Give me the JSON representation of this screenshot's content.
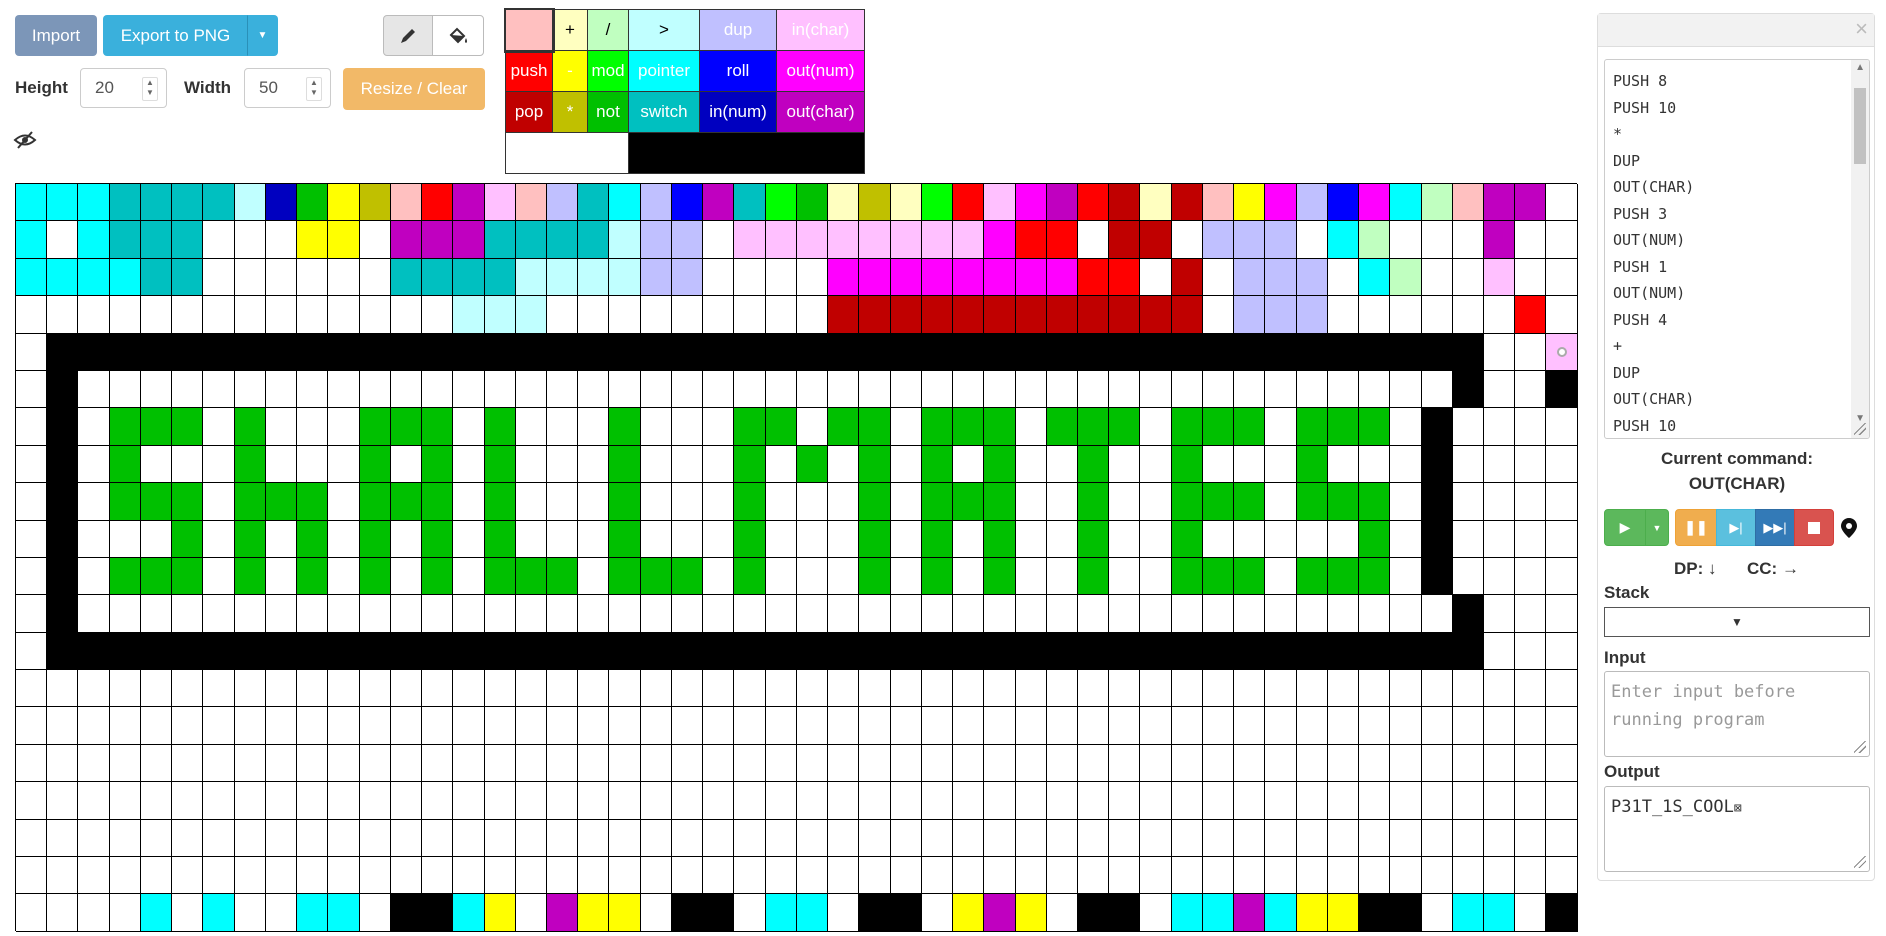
{
  "toolbar": {
    "import_label": "Import",
    "export_label": "Export to PNG",
    "height_label": "Height",
    "height_value": "20",
    "width_label": "Width",
    "width_value": "50",
    "resize_label": "Resize / Clear",
    "icons": {
      "pencil": "pencil-icon",
      "fill": "paint-bucket-icon",
      "eye": "eye-slash-icon"
    }
  },
  "palette": {
    "rows": [
      [
        {
          "label": "",
          "bg": "#ffc0c0",
          "fg": "#000",
          "selected": true
        },
        {
          "label": "+",
          "bg": "#ffffc0",
          "fg": "#000"
        },
        {
          "label": "/",
          "bg": "#c0ffc0",
          "fg": "#000"
        },
        {
          "label": ">",
          "bg": "#c0ffff",
          "fg": "#000"
        },
        {
          "label": "dup",
          "bg": "#c0c0ff",
          "fg": "#fff"
        },
        {
          "label": "in(char)",
          "bg": "#ffc0ff",
          "fg": "#fff"
        }
      ],
      [
        {
          "label": "push",
          "bg": "#ff0000",
          "fg": "#fff"
        },
        {
          "label": "-",
          "bg": "#ffff00",
          "fg": "#fff"
        },
        {
          "label": "mod",
          "bg": "#00ff00",
          "fg": "#fff"
        },
        {
          "label": "pointer",
          "bg": "#00ffff",
          "fg": "#fff"
        },
        {
          "label": "roll",
          "bg": "#0000ff",
          "fg": "#fff"
        },
        {
          "label": "out(num)",
          "bg": "#ff00ff",
          "fg": "#fff"
        }
      ],
      [
        {
          "label": "pop",
          "bg": "#c00000",
          "fg": "#fff"
        },
        {
          "label": "*",
          "bg": "#c0c000",
          "fg": "#fff"
        },
        {
          "label": "not",
          "bg": "#00c000",
          "fg": "#fff"
        },
        {
          "label": "switch",
          "bg": "#00c0c0",
          "fg": "#fff"
        },
        {
          "label": "in(num)",
          "bg": "#0000c0",
          "fg": "#fff"
        },
        {
          "label": "out(char)",
          "bg": "#c000c0",
          "fg": "#fff"
        }
      ]
    ]
  },
  "grid": {
    "rows": 20,
    "cols": 50,
    "colors": {
      "c": "#00ffff",
      "C": "#00c0c0",
      "e": "#c0ffff",
      "b": "#0000ff",
      "B": "#0000c0",
      "v": "#c0c0ff",
      "g": "#00ff00",
      "G": "#00c000",
      "h": "#c0ffc0",
      "y": "#ffff00",
      "Y": "#c0c000",
      "l": "#ffffc0",
      "r": "#ff0000",
      "R": "#c00000",
      "p": "#ffc0c0",
      "m": "#ff00ff",
      "M": "#c000c0",
      "n": "#ffc0ff",
      "k": "#000000",
      "w": "#ffffff"
    },
    "cells": [
      "cccCCCCeBGyYprMnpvCcvbMCgGlYlgrnmMrRlRpymvbmchpMM",
      "cwcCCCwwwyywMMMCCCCevvwnnnnnnnnmrrwRRwvvvwchwwwM",
      "ccccCCwwwwwwCCCCeeeevvwwwwmmmmmmmmrrwRwvvvwchwwn",
      "wwwwwwwwwwwwwweeewwwwwwwwwRRRRRRRRRRRRwvvvwwwwwwr",
      "wkkkkkkkkkkkkkkkkkkkkkkkkkkkkkkkkkkkkkkkkkkkkkkwwn",
      "wkwwwwwwwwwwwwwwwwwwwwwwwwwwwwwwwwwwwwwwwwwwwwkwwk",
      "wkwGGGwGwwwGGGwGwwwGwwwGGwGGwGGGwGGGwGGGwGGGwkwww",
      "wkwGwwwGwwwGwGwGwwwGwwwGwGwGwGwGwwGwwGwwwGwwwkwww",
      "wkwGGGwGGGwGGGwGwwwGwwwGwwwGwGGGwwGwwGGGwGGGwkwww",
      "wkwwwGwGwGwGwGwGwwwGwwwGwwwGwGwGwwGwwGwwwwwGwkwww",
      "wkwGGGwGwGwGwGwGGGwGGGwGwwwGwGwGwwGwwGGGwGGGwkwww",
      "wkwwwwwwwwwwwwwwwwwwwwwwwwwwwwwwwwwwwwwwwwwwwwkwww",
      "wkkkkkkkkkkkkkkkkkkkkkkkkkkkkkkkkkkkkkkkkkkkkkkwww",
      "wwwwwwwwwwwwwwwwwwwwwwwwwwwwwwwwwwwwwwwwwwwwwwwwww",
      "wwwwwwwwwwwwwwwwwwwwwwwwwwwwwwwwwwwwwwwwwwwwwwwwww",
      "wwwwwwwwwwwwwwwwwwwwwwwwwwwwwwwwwwwwwwwwwwwwwwwwww",
      "wwwwwwwwwwwwwwwwwwwwwwwwwwwwwwwwwwwwwwwwwwwwwwwwww",
      "wwwwwwwwwwwwwwwwwwwwwwwwwwwwwwwwwwwwwwwwwwwwwwwwww",
      "wwwwwwwwwwwwwwwwwwwwwwwwwwwwwwwwwwwwwwwwwwwwwwwwww",
      "wwwwcwcwwccwkkcywMyywkkwccwkkwyMywkkwccMcyykkwccwk"
    ],
    "current_cell": {
      "row": 4,
      "col": 49
    }
  },
  "panel": {
    "program_lines": [
      "PUSH 8",
      "PUSH 10",
      "*",
      "DUP",
      "OUT(CHAR)",
      "PUSH 3",
      "OUT(NUM)",
      "PUSH 1",
      "OUT(NUM)",
      "PUSH 4",
      "+",
      "DUP",
      "OUT(CHAR)",
      "PUSH 10"
    ],
    "current_command_label": "Current command:",
    "current_command": "OUT(CHAR)",
    "dp_label": "DP:",
    "dp_arrow": "↓",
    "cc_label": "CC:",
    "cc_arrow": "→",
    "stack_label": "Stack",
    "input_label": "Input",
    "input_placeholder": "Enter input before running program",
    "output_label": "Output",
    "output_value": "P31T_1S_COOL",
    "output_unprintable": "⊠"
  }
}
